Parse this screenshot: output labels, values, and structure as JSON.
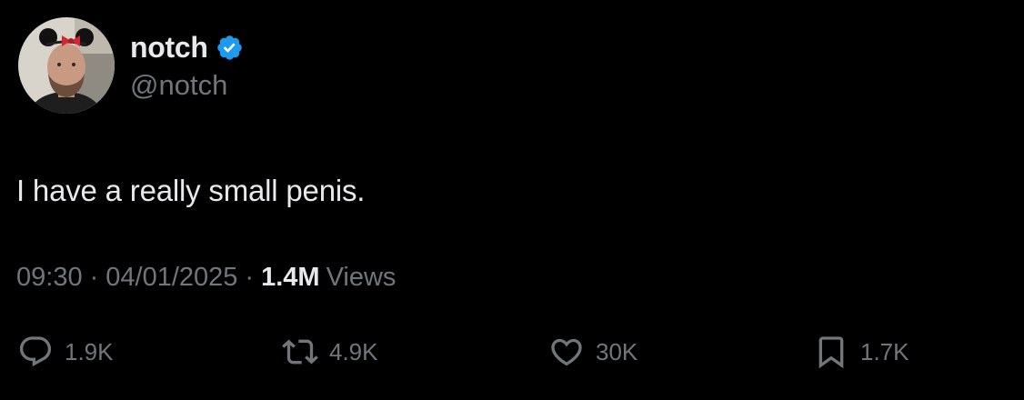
{
  "author": {
    "display_name": "notch",
    "handle": "@notch",
    "verified": true,
    "verified_color": "#1d9bf0"
  },
  "tweet": {
    "text": "I have a really small penis.",
    "time": "09:30",
    "date": "04/01/2025",
    "separator": "·",
    "views_count": "1.4M",
    "views_label": "Views"
  },
  "actions": {
    "reply": {
      "icon": "reply-icon",
      "count": "1.9K"
    },
    "retweet": {
      "icon": "retweet-icon",
      "count": "4.9K"
    },
    "like": {
      "icon": "heart-icon",
      "count": "30K"
    },
    "bookmark": {
      "icon": "bookmark-icon",
      "count": "1.7K"
    }
  },
  "colors": {
    "background": "#000000",
    "primary_text": "#e7e9ea",
    "secondary_text": "#71767b"
  }
}
